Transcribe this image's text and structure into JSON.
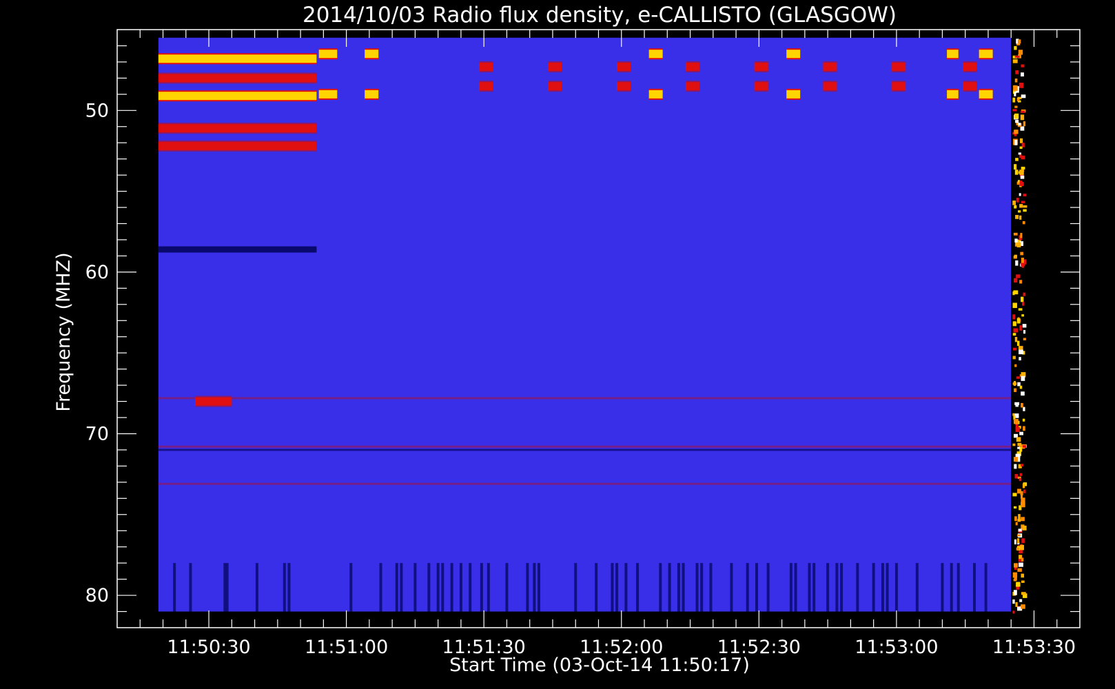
{
  "chart_data": {
    "type": "heatmap",
    "title": "2014/10/03  Radio flux density, e-CALLISTO (GLASGOW)",
    "xlabel": "Start Time (03-Oct-14 11:50:17)",
    "ylabel": "Frequency (MHZ)",
    "x_unit": "seconds after 11:50:00",
    "xlim": [
      10,
      220
    ],
    "ylim": [
      45,
      82
    ],
    "y_inverted": true,
    "data_x_range": [
      19,
      205
    ],
    "data_y_range": [
      45.5,
      81
    ],
    "x_ticks": [
      {
        "value": 30,
        "label": "11:50:30"
      },
      {
        "value": 60,
        "label": "11:51:00"
      },
      {
        "value": 90,
        "label": "11:51:30"
      },
      {
        "value": 120,
        "label": "11:52:00"
      },
      {
        "value": 150,
        "label": "11:52:30"
      },
      {
        "value": 180,
        "label": "11:53:00"
      },
      {
        "value": 210,
        "label": "11:53:30"
      }
    ],
    "y_ticks": [
      {
        "value": 50,
        "label": "50"
      },
      {
        "value": 60,
        "label": "60"
      },
      {
        "value": 70,
        "label": "70"
      },
      {
        "value": 80,
        "label": "80"
      }
    ],
    "background_color": "#3a2fe8",
    "colors": {
      "low": "#0a0a6e",
      "base": "#3a2fe8",
      "mid": "#8a1a6a",
      "high": "#e01010",
      "peak": "#ffd400",
      "max": "#ffffff"
    },
    "bursts": [
      {
        "t_start": 19,
        "t_end": 53.5,
        "f": 46.8,
        "level": "peak"
      },
      {
        "t_start": 19,
        "t_end": 53.5,
        "f": 49.1,
        "level": "peak"
      },
      {
        "t_start": 19,
        "t_end": 53.5,
        "f": 48.0,
        "level": "high"
      },
      {
        "t_start": 19,
        "t_end": 53.5,
        "f": 51.1,
        "level": "high"
      },
      {
        "t_start": 19,
        "t_end": 53.5,
        "f": 52.2,
        "level": "high"
      },
      {
        "t_start": 19,
        "t_end": 53.5,
        "f": 58.6,
        "level": "low"
      },
      {
        "t_start": 27,
        "t_end": 35,
        "f": 68.0,
        "level": "high"
      },
      {
        "t_start": 54,
        "t_end": 58,
        "f": 46.5,
        "level": "peak"
      },
      {
        "t_start": 54,
        "t_end": 58,
        "f": 49.0,
        "level": "peak"
      },
      {
        "t_start": 64,
        "t_end": 67,
        "f": 46.5,
        "level": "peak"
      },
      {
        "t_start": 64,
        "t_end": 67,
        "f": 49.0,
        "level": "peak"
      },
      {
        "t_start": 89,
        "t_end": 92,
        "f": 47.3,
        "level": "high"
      },
      {
        "t_start": 89,
        "t_end": 92,
        "f": 48.5,
        "level": "high"
      },
      {
        "t_start": 104,
        "t_end": 107,
        "f": 47.3,
        "level": "high"
      },
      {
        "t_start": 104,
        "t_end": 107,
        "f": 48.5,
        "level": "high"
      },
      {
        "t_start": 119,
        "t_end": 122,
        "f": 47.3,
        "level": "high"
      },
      {
        "t_start": 119,
        "t_end": 122,
        "f": 48.5,
        "level": "high"
      },
      {
        "t_start": 126,
        "t_end": 129,
        "f": 46.5,
        "level": "peak"
      },
      {
        "t_start": 126,
        "t_end": 129,
        "f": 49.0,
        "level": "peak"
      },
      {
        "t_start": 134,
        "t_end": 137,
        "f": 47.3,
        "level": "high"
      },
      {
        "t_start": 134,
        "t_end": 137,
        "f": 48.5,
        "level": "high"
      },
      {
        "t_start": 149,
        "t_end": 152,
        "f": 47.3,
        "level": "high"
      },
      {
        "t_start": 149,
        "t_end": 152,
        "f": 48.5,
        "level": "high"
      },
      {
        "t_start": 156,
        "t_end": 159,
        "f": 46.5,
        "level": "peak"
      },
      {
        "t_start": 156,
        "t_end": 159,
        "f": 49.0,
        "level": "peak"
      },
      {
        "t_start": 164,
        "t_end": 167,
        "f": 47.3,
        "level": "high"
      },
      {
        "t_start": 164,
        "t_end": 167,
        "f": 48.5,
        "level": "high"
      },
      {
        "t_start": 179,
        "t_end": 182,
        "f": 47.3,
        "level": "high"
      },
      {
        "t_start": 179,
        "t_end": 182,
        "f": 48.5,
        "level": "high"
      },
      {
        "t_start": 191,
        "t_end": 193.5,
        "f": 46.5,
        "level": "peak"
      },
      {
        "t_start": 191,
        "t_end": 193.5,
        "f": 49.0,
        "level": "peak"
      },
      {
        "t_start": 194.5,
        "t_end": 197.5,
        "f": 47.3,
        "level": "high"
      },
      {
        "t_start": 194.5,
        "t_end": 197.5,
        "f": 48.5,
        "level": "high"
      },
      {
        "t_start": 198,
        "t_end": 201,
        "f": 46.5,
        "level": "peak"
      },
      {
        "t_start": 198,
        "t_end": 201,
        "f": 49.0,
        "level": "peak"
      }
    ],
    "frequency_bands": [
      {
        "f": 70.8,
        "level": "mid"
      },
      {
        "f": 73.1,
        "level": "mid"
      },
      {
        "f": 71.0,
        "level": "low"
      },
      {
        "f": 67.8,
        "level": "mid"
      }
    ],
    "dark_streaks": {
      "f_start": 78,
      "f_end": 81,
      "times": [
        22.5,
        26,
        33.5,
        34,
        40.5,
        46.5,
        47.5,
        61,
        67.5,
        71,
        72,
        75,
        78,
        80,
        81,
        83,
        85,
        87,
        89.5,
        91,
        95,
        99.5,
        101,
        102,
        110,
        114.5,
        118,
        119,
        121,
        123.5,
        128.5,
        130.5,
        132.5,
        133.5,
        136.5,
        137.5,
        139.5,
        144,
        147.5,
        149.5,
        152,
        157,
        158,
        161,
        162,
        165,
        167,
        168,
        171.5,
        175,
        177,
        178,
        180,
        184.5,
        190,
        192,
        193.5,
        197,
        199.5
      ]
    }
  }
}
